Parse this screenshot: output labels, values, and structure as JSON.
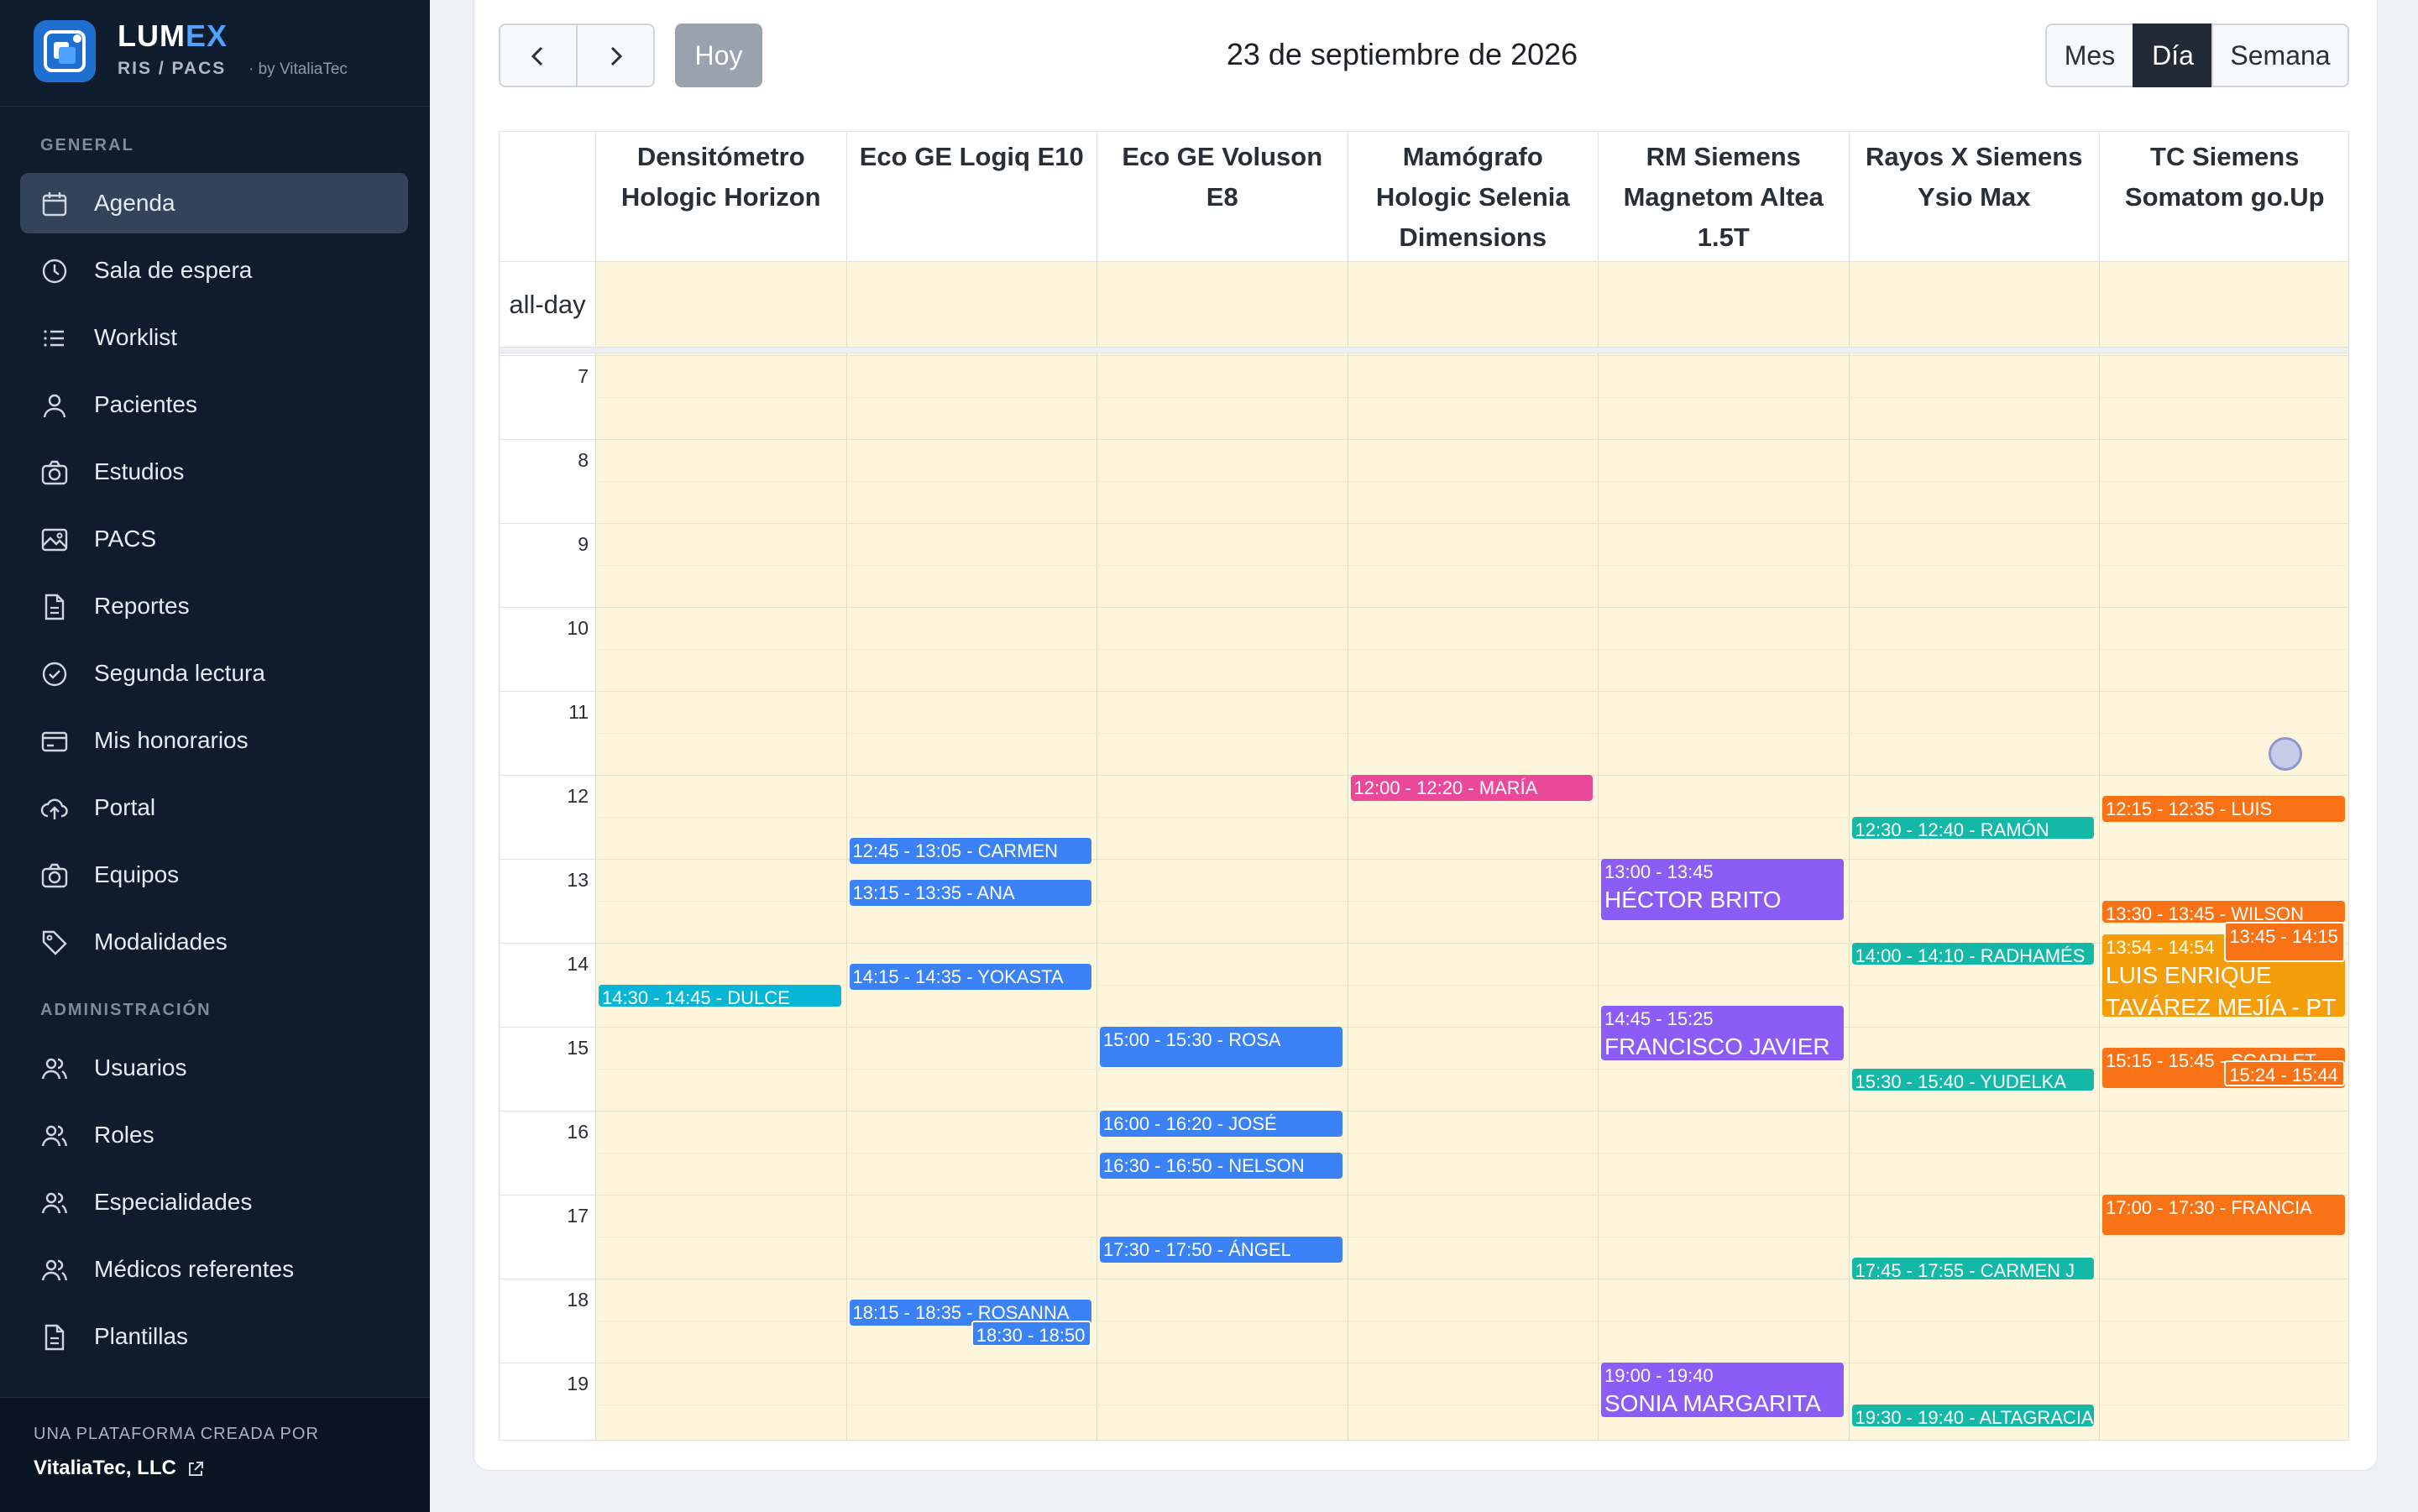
{
  "brand": {
    "name_a": "LUM",
    "name_b": "EX",
    "subtitle": "RIS / PACS",
    "by": "· by VitaliaTec"
  },
  "sidebar": {
    "section_general": "GENERAL",
    "section_admin": "ADMINISTRACIÓN",
    "items": [
      {
        "label": "Agenda",
        "icon": "calendar-icon",
        "active": true
      },
      {
        "label": "Sala de espera",
        "icon": "clock-icon"
      },
      {
        "label": "Worklist",
        "icon": "list-icon"
      },
      {
        "label": "Pacientes",
        "icon": "user-icon"
      },
      {
        "label": "Estudios",
        "icon": "camera-icon"
      },
      {
        "label": "PACS",
        "icon": "image-icon"
      },
      {
        "label": "Reportes",
        "icon": "document-icon"
      },
      {
        "label": "Segunda lectura",
        "icon": "check-circle-icon"
      },
      {
        "label": "Mis honorarios",
        "icon": "credit-card-icon"
      },
      {
        "label": "Portal",
        "icon": "cloud-upload-icon"
      },
      {
        "label": "Equipos",
        "icon": "camera-icon"
      },
      {
        "label": "Modalidades",
        "icon": "tag-icon"
      }
    ],
    "admin_items": [
      {
        "label": "Usuarios",
        "icon": "users-icon"
      },
      {
        "label": "Roles",
        "icon": "users-icon"
      },
      {
        "label": "Especialidades",
        "icon": "users-icon"
      },
      {
        "label": "Médicos referentes",
        "icon": "users-icon"
      },
      {
        "label": "Plantillas",
        "icon": "document-icon"
      }
    ],
    "footer_line1": "UNA PLATAFORMA CREADA POR",
    "footer_line2": "VitaliaTec, LLC"
  },
  "toolbar": {
    "today": "Hoy",
    "title": "23 de septiembre de 2026",
    "view_month": "Mes",
    "view_day": "Día",
    "view_week": "Semana"
  },
  "calendar": {
    "allday_label": "all-day",
    "hours": [
      "7",
      "8",
      "9",
      "10",
      "11",
      "12",
      "13",
      "14",
      "15",
      "16",
      "17",
      "18",
      "19"
    ],
    "columns": [
      {
        "lines": [
          "Densitómetro",
          "Hologic Horizon"
        ]
      },
      {
        "lines": [
          "Eco GE Logiq E10"
        ]
      },
      {
        "lines": [
          "Eco GE Voluson",
          "E8"
        ]
      },
      {
        "lines": [
          "Mamógrafo",
          "Hologic Selenia",
          "Dimensions"
        ]
      },
      {
        "lines": [
          "RM Siemens",
          "Magnetom Altea",
          "1.5T"
        ]
      },
      {
        "lines": [
          "Rayos X Siemens",
          "Ysio Max"
        ]
      },
      {
        "lines": [
          "TC Siemens",
          "Somatom go.Up"
        ]
      }
    ],
    "colors": {
      "blue": "#3b82f6",
      "purple": "#8b5cf6",
      "pink": "#ec4899",
      "teal": "#14b8a6",
      "cyan": "#06b6d4",
      "orange": "#f97316",
      "amber": "#f59e0b"
    },
    "events": [
      {
        "col": 0,
        "start": "14:30",
        "end": "14:45",
        "label": "14:30 - 14:45 - DULCE",
        "color": "cyan"
      },
      {
        "col": 1,
        "start": "12:45",
        "end": "13:05",
        "label": "12:45 - 13:05 - CARMEN",
        "color": "blue"
      },
      {
        "col": 1,
        "start": "13:15",
        "end": "13:35",
        "label": "13:15 - 13:35 - ANA",
        "color": "blue"
      },
      {
        "col": 1,
        "start": "14:15",
        "end": "14:35",
        "label": "14:15 - 14:35 - YOKASTA",
        "color": "blue"
      },
      {
        "col": 1,
        "start": "18:15",
        "end": "18:35",
        "label": "18:15 - 18:35 - ROSANNA",
        "color": "blue"
      },
      {
        "col": 1,
        "start": "18:30",
        "end": "18:50",
        "label": "18:30 - 18:50",
        "color": "blue",
        "offset": true
      },
      {
        "col": 2,
        "start": "15:00",
        "end": "15:30",
        "label": "15:00 - 15:30 - ROSA",
        "color": "blue"
      },
      {
        "col": 2,
        "start": "16:00",
        "end": "16:20",
        "label": "16:00 - 16:20 - JOSÉ",
        "color": "blue"
      },
      {
        "col": 2,
        "start": "16:30",
        "end": "16:50",
        "label": "16:30 - 16:50 - NELSON",
        "color": "blue"
      },
      {
        "col": 2,
        "start": "17:30",
        "end": "17:50",
        "label": "17:30 - 17:50 - ÁNGEL",
        "color": "blue"
      },
      {
        "col": 3,
        "start": "12:00",
        "end": "12:20",
        "label": "12:00 - 12:20 - MARÍA",
        "color": "pink"
      },
      {
        "col": 4,
        "start": "13:00",
        "end": "13:45",
        "label": "13:00 - 13:45",
        "name": "HÉCTOR BRITO",
        "color": "purple"
      },
      {
        "col": 4,
        "start": "14:45",
        "end": "15:25",
        "label": "14:45 - 15:25",
        "name": "FRANCISCO JAVIER",
        "color": "purple"
      },
      {
        "col": 4,
        "start": "19:00",
        "end": "19:40",
        "label": "19:00 - 19:40",
        "name": "SONIA MARGARITA",
        "color": "purple"
      },
      {
        "col": 5,
        "start": "12:30",
        "end": "12:40",
        "label": "12:30 - 12:40 - RAMÓN",
        "color": "teal"
      },
      {
        "col": 5,
        "start": "14:00",
        "end": "14:10",
        "label": "14:00 - 14:10 - RADHAMÉS",
        "color": "teal"
      },
      {
        "col": 5,
        "start": "15:30",
        "end": "15:40",
        "label": "15:30 - 15:40 - YUDELKA",
        "color": "teal"
      },
      {
        "col": 5,
        "start": "17:45",
        "end": "17:55",
        "label": "17:45 - 17:55 - CARMEN J",
        "color": "teal"
      },
      {
        "col": 5,
        "start": "19:30",
        "end": "19:40",
        "label": "19:30 - 19:40 - ALTAGRACIA",
        "color": "teal"
      },
      {
        "col": 6,
        "start": "12:15",
        "end": "12:35",
        "label": "12:15 - 12:35 - LUIS",
        "color": "orange"
      },
      {
        "col": 6,
        "start": "13:30",
        "end": "13:45",
        "label": "13:30 - 13:45 - WILSON",
        "color": "orange"
      },
      {
        "col": 6,
        "start": "13:54",
        "end": "14:54",
        "label": "13:54 - 14:54",
        "name": "LUIS ENRIQUE",
        "name2": "TAVÁREZ MEJÍA - PT",
        "color": "amber"
      },
      {
        "col": 6,
        "start": "13:45",
        "end": "14:15",
        "label": "13:45 - 14:15",
        "color": "orange",
        "offset": true
      },
      {
        "col": 6,
        "start": "15:15",
        "end": "15:45",
        "label": "15:15 - 15:45 - SCARLET",
        "color": "orange"
      },
      {
        "col": 6,
        "start": "15:24",
        "end": "15:44",
        "label": "15:24 - 15:44",
        "color": "orange",
        "offset": true
      },
      {
        "col": 6,
        "start": "17:00",
        "end": "17:30",
        "label": "17:00 - 17:30 - FRANCIA",
        "color": "orange"
      }
    ]
  }
}
